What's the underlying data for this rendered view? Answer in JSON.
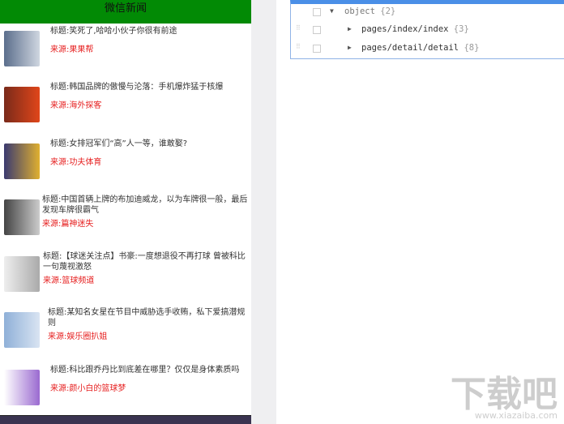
{
  "header": {
    "title": "微信新闻"
  },
  "news": [
    {
      "title": "标题:笑死了,哈哈小伙子你很有前途",
      "source": "来源:果果帮"
    },
    {
      "title": "标题:韩国品牌的傲慢与沦落：手机爆炸猛于核爆",
      "source": "来源:海外探客"
    },
    {
      "title": "标题:女排冠军们“高”人一等，谁敢娶?",
      "source": "来源:功夫体育"
    },
    {
      "title": "标题:中国首辆上牌的布加迪威龙，以为车牌很一般，最后发现车牌很霸气",
      "source": "来源:篇神迷失"
    },
    {
      "title": "标题:【球迷关注点】书豪:一度想退役不再打球 曾被科比一句蔑视激怒",
      "source": "来源:篮球频道"
    },
    {
      "title": "标题:某知名女星在节目中威胁选手收贿，私下爱搞潜规则",
      "source": "来源:娱乐圈扒姐"
    },
    {
      "title": "标题:科比跟乔丹比到底差在哪里？仅仅是身体素质吗",
      "source": "来源:颜小白的篮球梦"
    }
  ],
  "json_tree": {
    "root": {
      "key": "object",
      "count": "{2}"
    },
    "children": [
      {
        "key": "pages/index/index",
        "count": "{3}"
      },
      {
        "key": "pages/detail/detail",
        "count": "{8}"
      }
    ]
  },
  "watermark": {
    "text": "下载吧",
    "url": "www.xiazaiba.com"
  }
}
